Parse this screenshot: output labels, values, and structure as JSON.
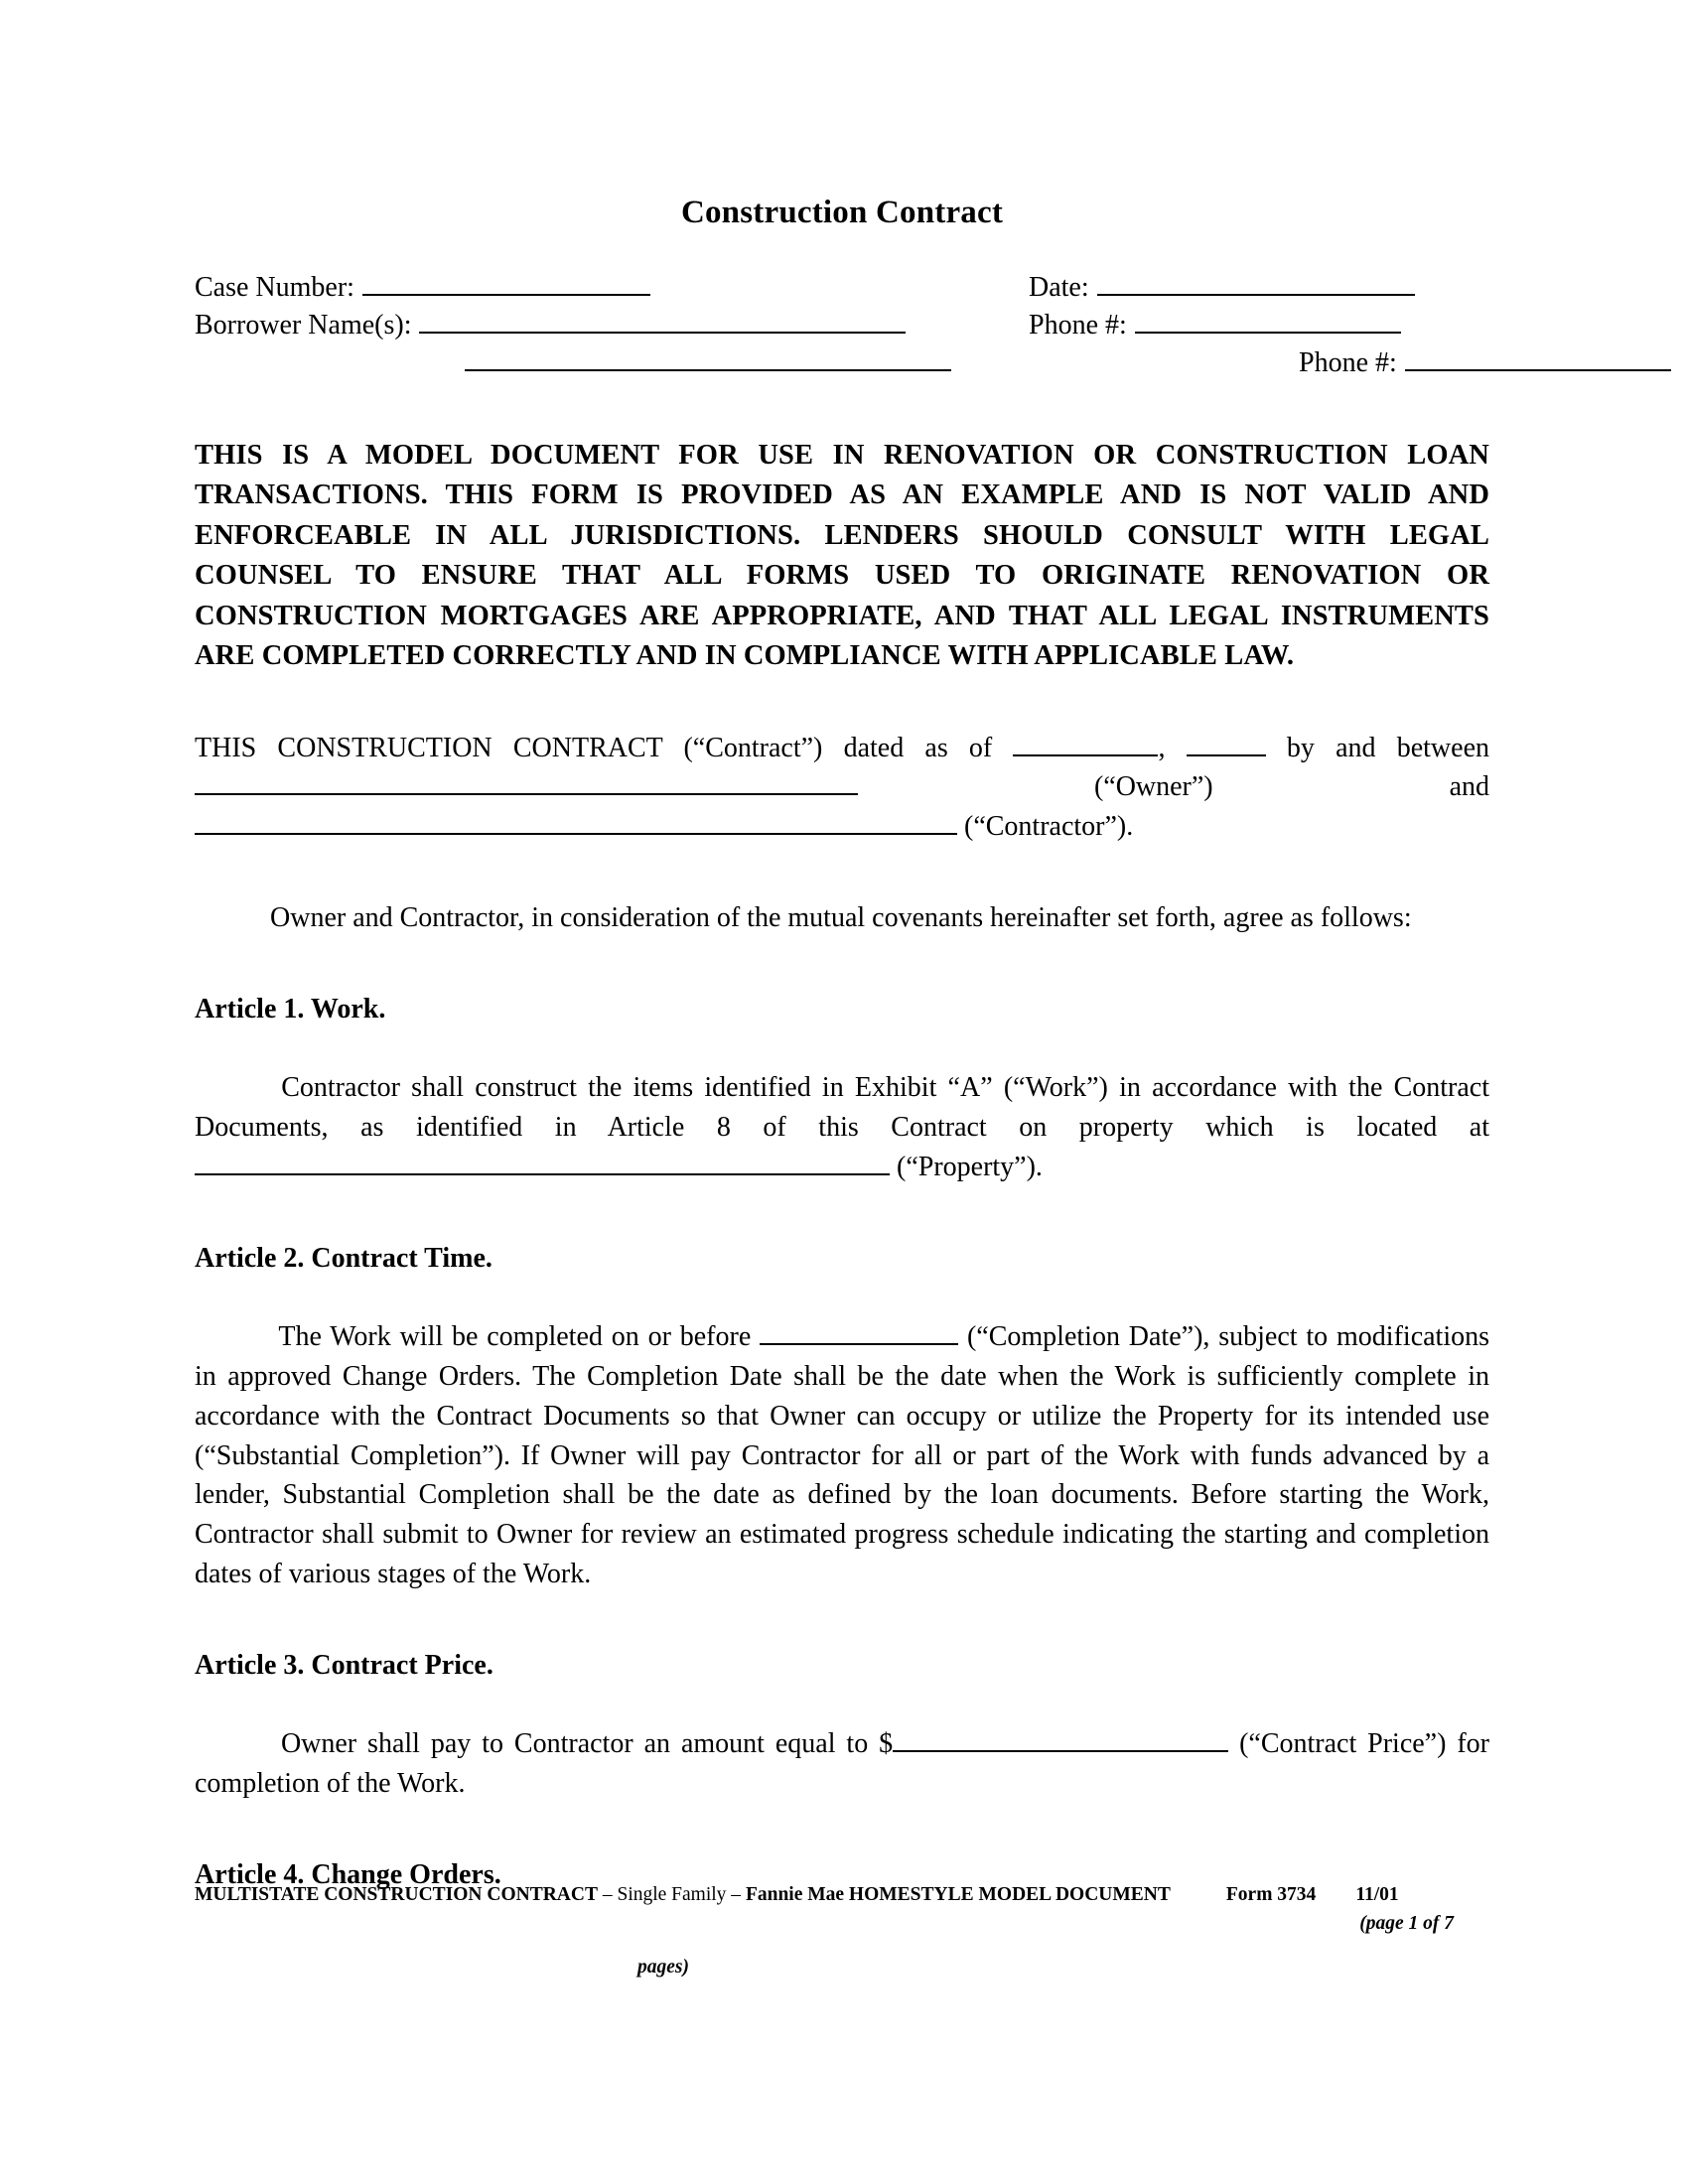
{
  "document": {
    "title": "Construction Contract"
  },
  "header_fields": {
    "case_number_label": "Case Number:",
    "borrower_label": "Borrower Name(s):",
    "date_label": "Date:",
    "phone_label_1": "Phone #:",
    "phone_label_2": "Phone #:"
  },
  "notice": {
    "text": "THIS IS A MODEL DOCUMENT FOR USE IN RENOVATION OR CONSTRUCTION LOAN TRANSACTIONS.  THIS FORM IS PROVIDED AS AN EXAMPLE AND IS NOT VALID AND ENFORCEABLE IN ALL JURISDICTIONS. LENDERS SHOULD CONSULT WITH LEGAL COUNSEL TO ENSURE THAT ALL FORMS USED TO ORIGINATE RENOVATION OR CONSTRUCTION MORTGAGES ARE APPROPRIATE, AND THAT ALL LEGAL INSTRUMENTS ARE COMPLETED CORRECTLY AND IN COMPLIANCE WITH APPLICABLE LAW."
  },
  "preamble": {
    "lead": "THIS CONSTRUCTION CONTRACT (“Contract”) dated as of",
    "after_date_comma": ",",
    "after_year": "by and",
    "between_label": "between",
    "owner_tag": "(“Owner”)  and",
    "contractor_tag": "(“Contractor”)."
  },
  "recital": {
    "text": "Owner and Contractor, in consideration of the mutual covenants hereinafter set forth, agree as follows:"
  },
  "articles": [
    {
      "heading": "Article 1. Work.",
      "body_before_blank": "Contractor shall construct the items identified in Exhibit “A” (“Work”) in accordance with the Contract Documents, as identified in Article 8 of this Contract on property which is located at",
      "body_after_blank": "(“Property”)."
    },
    {
      "heading": "Article 2. Contract Time.",
      "body_part_1": "The Work will be completed on or before",
      "body_part_2": "(“Completion Date”), subject to modifications in approved Change Orders.  The Completion Date shall be the date when the Work is sufficiently complete in accordance with the Contract Documents so that Owner can occupy or utilize the Property for its intended use (“Substantial Completion”).  If Owner will pay Contractor for all or part of the Work with funds advanced by a lender, Substantial Completion shall be the date as defined by the loan documents.  Before starting the Work, Contractor shall submit to Owner for review an estimated progress schedule indicating the starting and completion dates of various stages of the Work."
    },
    {
      "heading": "Article 3. Contract Price.",
      "body_part_1": "Owner shall pay to Contractor an amount equal to $",
      "body_part_2": "(“Contract Price”) for completion of the Work."
    },
    {
      "heading": "Article 4. Change Orders."
    }
  ],
  "footer": {
    "main_bold_1": "MULTISTATE CONSTRUCTION CONTRACT",
    "main_reg_1": " – Single Family – ",
    "main_bold_2": "Fannie Mae",
    "main_bold_3": " HOMESTYLE MODEL DOCUMENT",
    "form": "Form 3734",
    "date": "11/01",
    "page": "(page  1 of 7",
    "pages": "pages)"
  }
}
